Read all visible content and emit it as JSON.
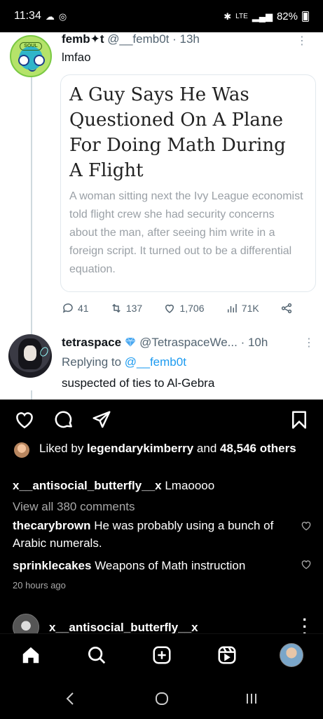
{
  "status_bar": {
    "time": "11:34",
    "network": "LTE",
    "battery": "82%"
  },
  "tweet1": {
    "name": "femb✦t",
    "handle": "@__femb0t",
    "time": "13h",
    "text": "lmfao",
    "card_headline": "A Guy Says He Was Questioned On A Plane For Doing Math During A Flight",
    "card_sub": "A woman sitting next the Ivy League economist told flight crew she had security concerns about the man, after seeing him write in a foreign script. It turned out to be a differential equation.",
    "replies": "41",
    "retweets": "137",
    "likes": "1,706",
    "views": "71K"
  },
  "tweet2": {
    "name": "tetraspace",
    "handle": "@TetraspaceWe...",
    "time": "10h",
    "replying_prefix": "Replying to ",
    "replying_handle": "@__femb0t",
    "text": "suspected of ties to Al-Gebra"
  },
  "post": {
    "liked_prefix": "Liked by ",
    "liked_user": "legendarykimberry",
    "liked_and": " and ",
    "liked_count": "48,546 others",
    "caption_user": "x__antisocial_butterfly__x",
    "caption_text": " Lmaoooo",
    "view_all": "View all 380 comments",
    "comments": [
      {
        "user": "thecarybrown",
        "text": " He was probably using a bunch of Arabic numerals."
      },
      {
        "user": "sprinklecakes",
        "text": " Weapons of Math instruction"
      }
    ],
    "timestamp": "20 hours ago"
  },
  "next_post": {
    "user": "x__antisocial_butterfly__x"
  },
  "colors": {
    "link_blue": "#1d9bf0",
    "muted_gray": "#536471",
    "ig_muted": "#a8a8a8"
  }
}
